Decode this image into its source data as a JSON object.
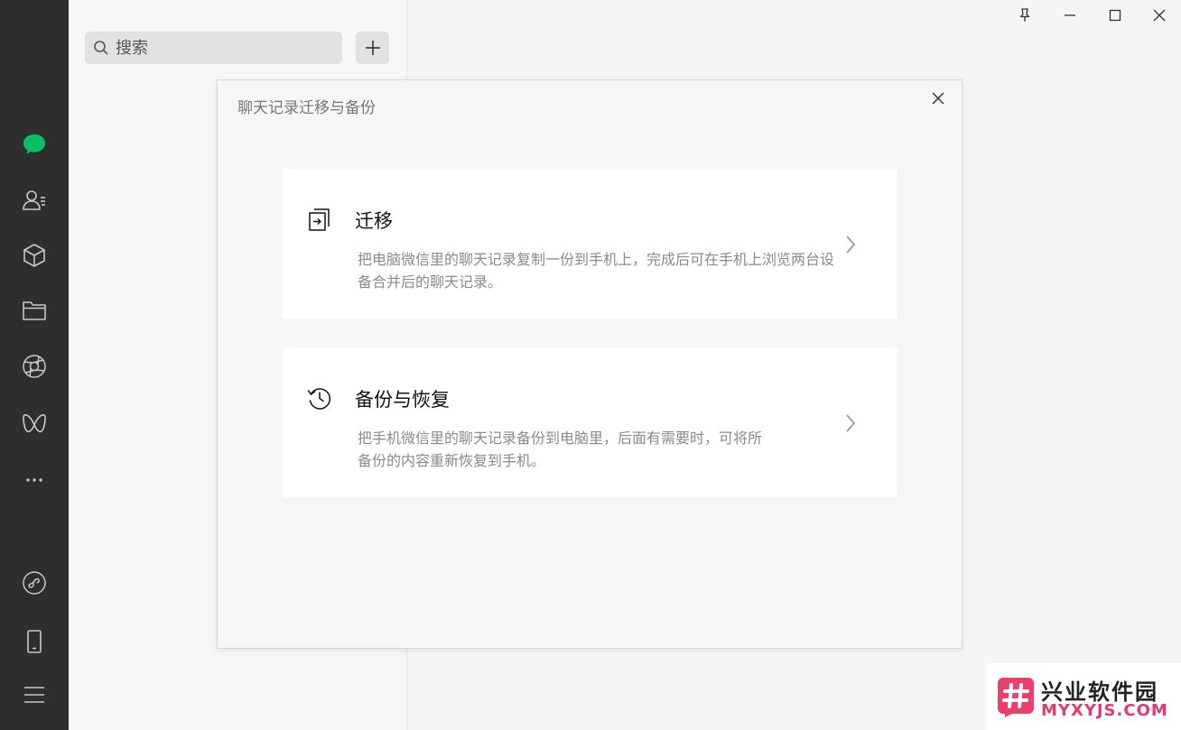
{
  "nav": {
    "items": [
      {
        "name": "chats",
        "icon": "chat-bubble-icon",
        "active": true
      },
      {
        "name": "contacts",
        "icon": "contacts-icon"
      },
      {
        "name": "favorites",
        "icon": "cube-icon"
      },
      {
        "name": "files",
        "icon": "folder-icon"
      },
      {
        "name": "moments",
        "icon": "aperture-icon"
      },
      {
        "name": "channels",
        "icon": "butterfly-icon"
      },
      {
        "name": "more",
        "icon": "more-dots-icon"
      },
      {
        "name": "mini-programs",
        "icon": "mini-program-icon"
      },
      {
        "name": "phone",
        "icon": "phone-icon"
      },
      {
        "name": "settings",
        "icon": "menu-icon"
      }
    ],
    "accent": "#07c160"
  },
  "search": {
    "placeholder": "搜索"
  },
  "window": {
    "controls": [
      "pin-icon",
      "minimize-icon",
      "maximize-icon",
      "close-icon"
    ]
  },
  "dialog": {
    "title": "聊天记录迁移与备份",
    "options": [
      {
        "title": "迁移",
        "description": "把电脑微信里的聊天记录复制一份到手机上，完成后可在手机上浏览两台设备合并后的聊天记录。",
        "icon": "migrate-icon"
      },
      {
        "title": "备份与恢复",
        "description": "把手机微信里的聊天记录备份到电脑里，后面有需要时，可将所备份的内容重新恢复到手机。",
        "icon": "history-icon"
      }
    ]
  },
  "watermark": {
    "name": "兴业软件园",
    "domain": "MYXYJS.COM"
  }
}
